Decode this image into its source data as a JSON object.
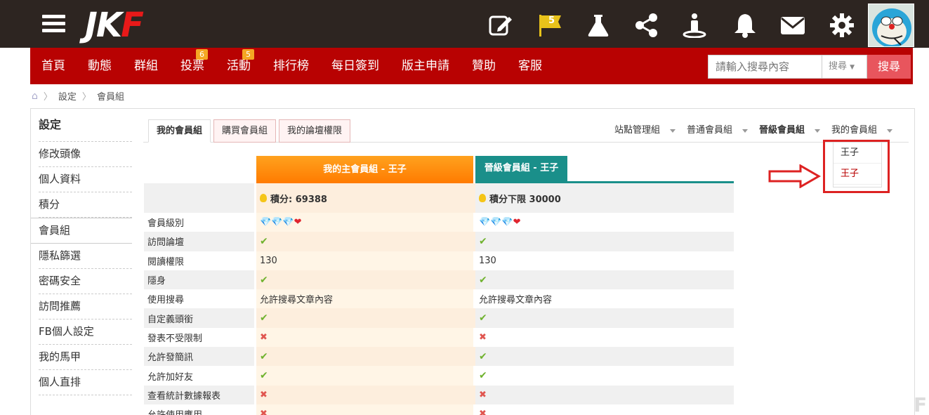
{
  "topbar": {
    "logo": [
      "J",
      "K",
      "F"
    ],
    "flag_badge": "5",
    "icons": [
      "edit-icon",
      "flag-icon",
      "flask-icon",
      "share-icon",
      "person-icon",
      "bell-icon",
      "mail-icon",
      "gear-icon"
    ]
  },
  "nav": {
    "items": [
      {
        "label": "首頁",
        "badge": ""
      },
      {
        "label": "動態",
        "badge": ""
      },
      {
        "label": "群組",
        "badge": ""
      },
      {
        "label": "投票",
        "badge": "6"
      },
      {
        "label": "活動",
        "badge": "5"
      },
      {
        "label": "排行榜",
        "badge": ""
      },
      {
        "label": "每日簽到",
        "badge": ""
      },
      {
        "label": "版主申請",
        "badge": ""
      },
      {
        "label": "贊助",
        "badge": ""
      },
      {
        "label": "客服",
        "badge": ""
      }
    ],
    "search_placeholder": "請輸入搜尋內容",
    "search_select": "搜尋",
    "search_button": "搜尋"
  },
  "breadcrumb": [
    "設定",
    "會員組"
  ],
  "sidebar": {
    "title": "設定",
    "items": [
      "修改頭像",
      "個人資料",
      "積分",
      "會員組",
      "隱私篩選",
      "密碼安全",
      "訪問推薦",
      "FB個人設定",
      "我的馬甲",
      "個人直排"
    ],
    "active_index": 3
  },
  "tabs": [
    "我的會員組",
    "購買會員組",
    "我的論壇權限"
  ],
  "right_tabs": [
    "站點管理組",
    "普通會員組",
    "晉級會員組",
    "我的會員組"
  ],
  "dropdown": [
    "王子",
    "王子"
  ],
  "columns": {
    "col1_title": "我的主會員組 - 王子",
    "col2_title": "晉級會員組 - 王子",
    "col1_points": "積分: 69388",
    "col2_points": "積分下限 30000"
  },
  "rows": [
    {
      "label": "會員級別",
      "v1": "level",
      "v2": "level"
    },
    {
      "label": "訪問論壇",
      "v1": "yes",
      "v2": "yes"
    },
    {
      "label": "閱讀權限",
      "v1": "130",
      "v2": "130"
    },
    {
      "label": "隱身",
      "v1": "yes",
      "v2": "yes"
    },
    {
      "label": "使用搜尋",
      "v1": "允許搜尋文章內容",
      "v2": "允許搜尋文章內容"
    },
    {
      "label": "自定義頭銜",
      "v1": "yes",
      "v2": "yes"
    },
    {
      "label": "發表不受限制",
      "v1": "no",
      "v2": "no"
    },
    {
      "label": "允許發簡訊",
      "v1": "yes",
      "v2": "yes"
    },
    {
      "label": "允許加好友",
      "v1": "yes",
      "v2": "yes"
    },
    {
      "label": "查看統計數據報表",
      "v1": "no",
      "v2": "no"
    },
    {
      "label": "允許使用應用",
      "v1": "no",
      "v2": "no"
    }
  ],
  "colors": {
    "topbar": "#2d2521",
    "nav": "#b80202",
    "accent_orange": "#ff7b00",
    "accent_teal": "#1a8f8a"
  }
}
